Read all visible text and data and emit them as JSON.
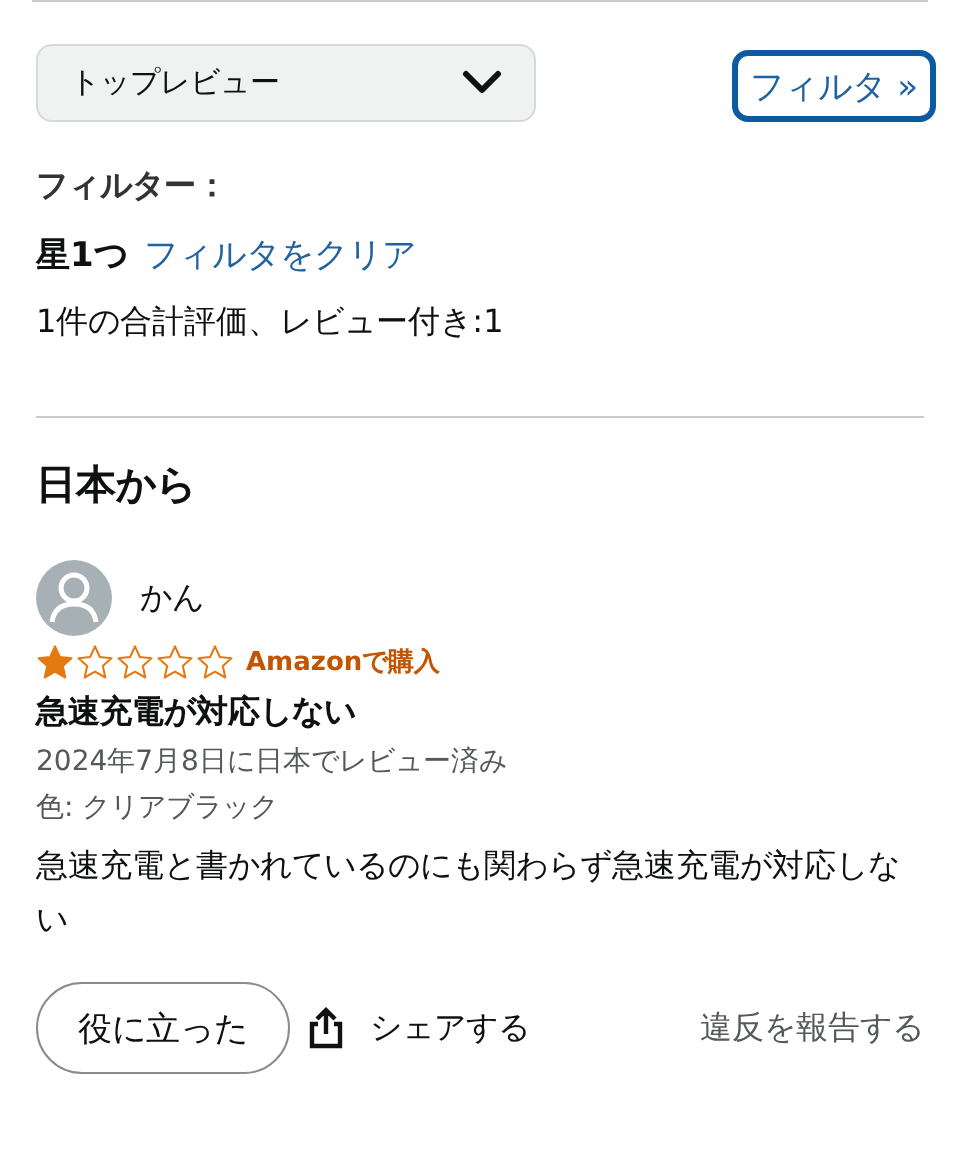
{
  "sort_dropdown": {
    "value": "トップレビュー"
  },
  "filter_button": {
    "label": "フィルタ »"
  },
  "filters": {
    "heading": "フィルター：",
    "active": "星1つ",
    "clear_link": "フィルタをクリア",
    "summary": "1件の合計評価、レビュー付き:1"
  },
  "section_heading": "日本から",
  "review": {
    "author": "かん",
    "stars": 1,
    "badge": "Amazonで購入",
    "title": "急速充電が対応しない",
    "date": "2024年7月8日に日本でレビュー済み",
    "variant": "色: クリアブラック",
    "body": "急速充電と書かれているのにも関わらず急速充電が対応しない"
  },
  "actions": {
    "helpful": "役に立った",
    "share": "シェアする",
    "report": "違反を報告する"
  }
}
